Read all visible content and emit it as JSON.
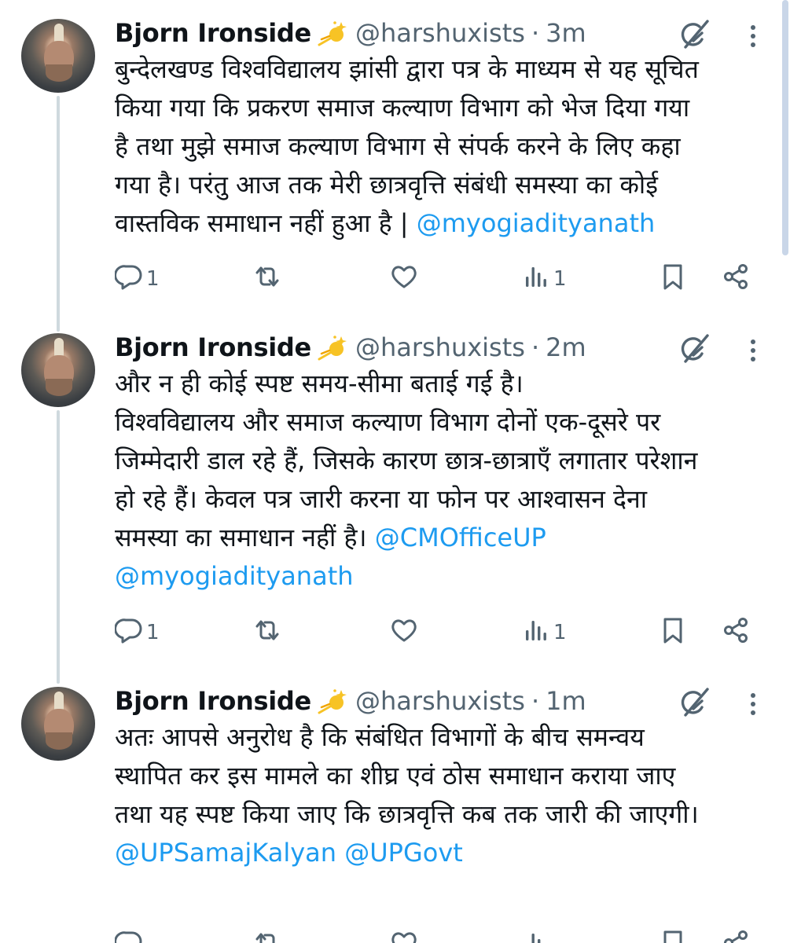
{
  "tweets": [
    {
      "author": "Bjorn Ironside",
      "handle": "@harshuxists",
      "separator": "·",
      "time": "3m",
      "lines": [
        [
          {
            "t": "बुन्देलखण्ड विश्वविद्यालय झांसी द्वारा पत्र के माध्यम से यह सूचित"
          }
        ],
        [
          {
            "t": "किया गया कि प्रकरण समाज कल्याण विभाग को भेज दिया गया"
          }
        ],
        [
          {
            "t": "है तथा मुझे समाज कल्याण विभाग से संपर्क करने के लिए कहा"
          }
        ],
        [
          {
            "t": "गया है। परंतु आज तक मेरी छात्रवृत्ति संबंधी समस्या का कोई"
          }
        ],
        [
          {
            "t": "वास्तविक समाधान नहीं हुआ है  | "
          },
          {
            "t": "@myogiadityanath",
            "m": true
          }
        ]
      ],
      "replies": "1",
      "views": "1"
    },
    {
      "author": "Bjorn Ironside",
      "handle": "@harshuxists",
      "separator": "·",
      "time": "2m",
      "lines": [
        [
          {
            "t": "और न ही कोई स्पष्ट समय-सीमा बताई गई है।"
          }
        ],
        [
          {
            "t": "विश्वविद्यालय और समाज कल्याण विभाग दोनों एक-दूसरे पर"
          }
        ],
        [
          {
            "t": "जिम्मेदारी डाल रहे हैं, जिसके कारण छात्र-छात्राएँ लगातार परेशान"
          }
        ],
        [
          {
            "t": "हो रहे हैं। केवल पत्र जारी करना या फोन पर आश्वासन देना"
          }
        ],
        [
          {
            "t": "समस्या का समाधान नहीं है। "
          },
          {
            "t": "@CMOfficeUP",
            "m": true
          }
        ],
        [
          {
            "t": "@myogiadityanath",
            "m": true
          }
        ]
      ],
      "replies": "1",
      "views": "1"
    },
    {
      "author": "Bjorn Ironside",
      "handle": "@harshuxists",
      "separator": "·",
      "time": "1m",
      "lines": [
        [
          {
            "t": "अतः आपसे अनुरोध है कि संबंधित विभागों के बीच समन्वय"
          }
        ],
        [
          {
            "t": "स्थापित कर इस मामले का शीघ्र एवं ठोस समाधान कराया जाए"
          }
        ],
        [
          {
            "t": "तथा यह स्पष्ट किया जाए कि छात्रवृत्ति कब तक जारी की जाएगी।"
          }
        ],
        [
          {
            "t": "@UPSamajKalyan",
            "m": true
          },
          {
            "t": " "
          },
          {
            "t": "@UPGovt",
            "m": true
          }
        ]
      ],
      "replies": "",
      "views": ""
    }
  ],
  "icons": {
    "badge": "sparkle-star-icon",
    "grok": "grok-icon",
    "more": "more-vertical-icon",
    "reply": "reply-icon",
    "retweet": "retweet-icon",
    "like": "like-icon",
    "views": "views-icon",
    "bookmark": "bookmark-icon",
    "share": "share-icon"
  },
  "colors": {
    "text": "#0f1419",
    "muted": "#536471",
    "mention": "#1d9bf0",
    "thread_line": "#cfd9de"
  }
}
